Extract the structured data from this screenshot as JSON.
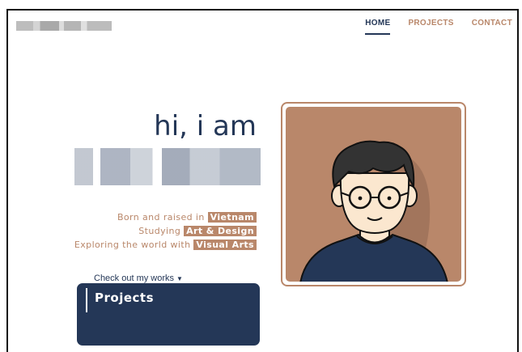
{
  "nav": {
    "items": [
      {
        "label": "HOME",
        "active": true
      },
      {
        "label": "PROJECTS",
        "active": false
      },
      {
        "label": "CONTACT",
        "active": false
      }
    ]
  },
  "hero": {
    "greeting": "hi, i am",
    "bio": [
      {
        "prefix": "Born and raised in",
        "highlight": "Vietnam"
      },
      {
        "prefix": "Studying",
        "highlight": "Art & Design"
      },
      {
        "prefix": "Exploring the world with",
        "highlight": "Visual Arts"
      }
    ],
    "cta_label": "Check out my works",
    "cta_icon": "chevron-down-icon"
  },
  "projects_section": {
    "title": "Projects"
  },
  "colors": {
    "primary": "#243757",
    "accent": "#b9876a",
    "background": "#ffffff"
  }
}
